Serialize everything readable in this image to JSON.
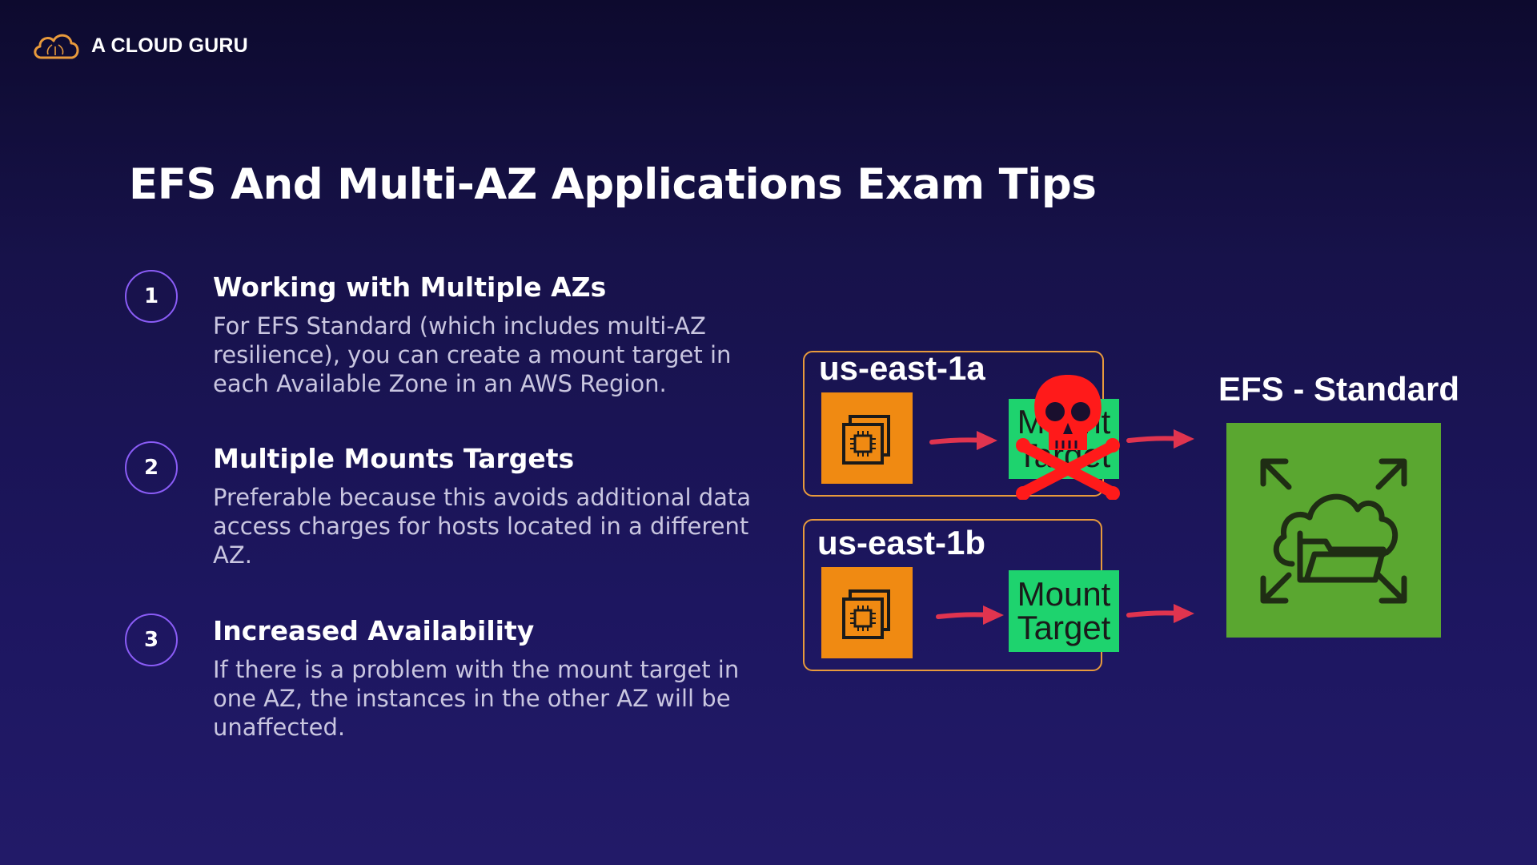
{
  "brand": {
    "name": "A CLOUD GURU",
    "icon": "cloud-logo-icon",
    "accent": "#e89a3c"
  },
  "title": "EFS And Multi-AZ Applications Exam Tips",
  "tips": [
    {
      "number": "1",
      "title": "Working with Multiple AZs",
      "body": "For EFS Standard (which includes multi-AZ resilience), you can create a mount target in each Available Zone in an AWS Region."
    },
    {
      "number": "2",
      "title": "Multiple Mounts Targets",
      "body": "Preferable because this avoids additional data access charges for hosts located in a different AZ."
    },
    {
      "number": "3",
      "title": "Increased Availability",
      "body": "If there is a problem with the mount target in one AZ, the instances in the other AZ will be unaffected."
    }
  ],
  "diagram": {
    "zones": [
      {
        "name": "us-east-1a",
        "mount_line1": "Mount",
        "mount_line2": "Target",
        "failed": true
      },
      {
        "name": "us-east-1b",
        "mount_line1": "Mount",
        "mount_line2": "Target",
        "failed": false
      }
    ],
    "efs_label": "EFS - Standard",
    "colors": {
      "ec2": "#f08a12",
      "mount_target": "#1ed36e",
      "efs": "#5aa730",
      "arrow": "#e0344f",
      "zone_border": "#e89a3c",
      "skull": "#ff1a1a"
    }
  }
}
